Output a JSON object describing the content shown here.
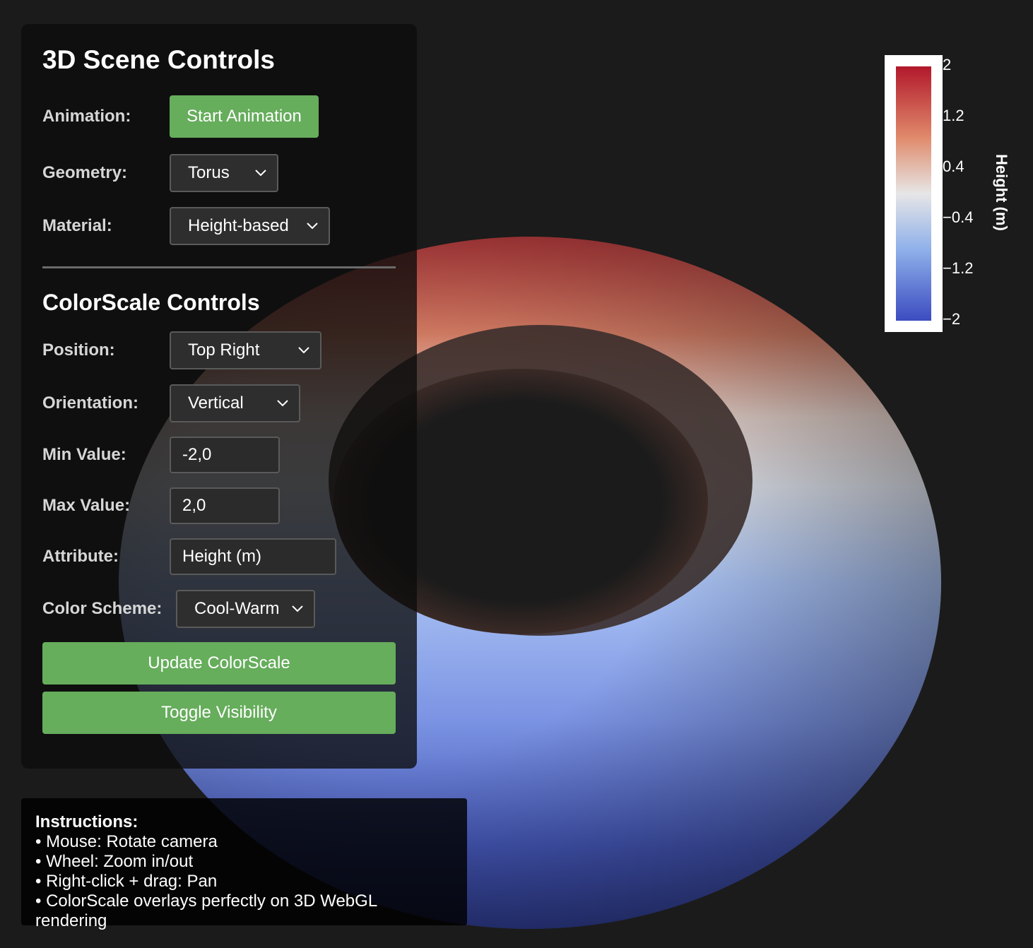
{
  "scene": {
    "geometry_shape": "torus",
    "colors": {
      "background": "#1b1b1b",
      "hot": "#b2182b",
      "mid": "#e6e6e6",
      "cold": "#3b4cc0"
    }
  },
  "scene_controls": {
    "title": "3D Scene Controls",
    "animation_label": "Animation:",
    "animation_button": "Start Animation",
    "geometry_label": "Geometry:",
    "geometry_value": "Torus",
    "material_label": "Material:",
    "material_value": "Height-based"
  },
  "colorscale_controls": {
    "title": "ColorScale Controls",
    "position_label": "Position:",
    "position_value": "Top Right",
    "orientation_label": "Orientation:",
    "orientation_value": "Vertical",
    "min_label": "Min Value:",
    "min_value": "-2,0",
    "max_label": "Max Value:",
    "max_value": "2,0",
    "attribute_label": "Attribute:",
    "attribute_value": "Height (m)",
    "scheme_label": "Color Scheme:",
    "scheme_value": "Cool-Warm",
    "update_button": "Update ColorScale",
    "toggle_button": "Toggle Visibility"
  },
  "instructions": {
    "title": "Instructions:",
    "lines": [
      "• Mouse: Rotate camera",
      "• Wheel: Zoom in/out",
      "• Right-click + drag: Pan",
      "• ColorScale overlays perfectly on 3D WebGL rendering"
    ]
  },
  "colorbar": {
    "title": "Height (m)",
    "ticks": [
      "2",
      "1.2",
      "0.4",
      "−0.4",
      "−1.2",
      "−2"
    ],
    "min": -2,
    "max": 2
  },
  "icons": {
    "dropdown": "chevron-down-icon"
  }
}
